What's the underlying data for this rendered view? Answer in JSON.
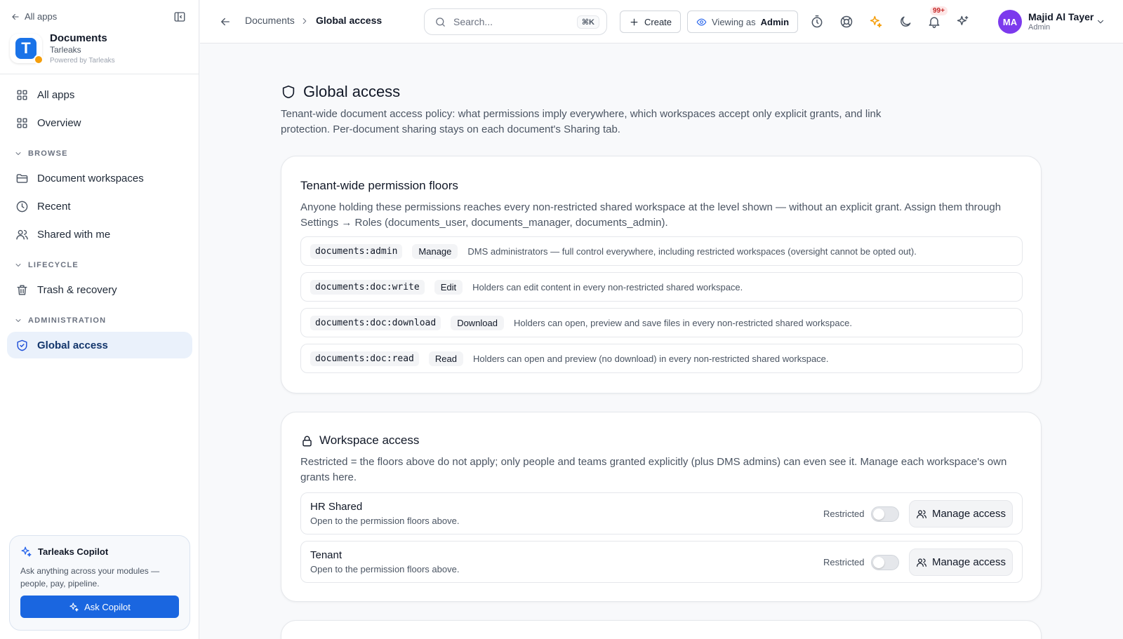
{
  "sidebar": {
    "all_apps": "All apps",
    "app": {
      "name": "Documents",
      "org": "Tarleaks",
      "powered": "Powered by Tarleaks",
      "logo_letter": "T"
    },
    "nav_top": [
      {
        "label": "All apps",
        "icon": "grid-icon"
      },
      {
        "label": "Overview",
        "icon": "grid-icon"
      }
    ],
    "sections": {
      "browse": "BROWSE",
      "lifecycle": "LIFECYCLE",
      "administration": "ADMINISTRATION"
    },
    "browse_items": [
      {
        "label": "Document workspaces",
        "icon": "folder-icon"
      },
      {
        "label": "Recent",
        "icon": "clock-icon"
      },
      {
        "label": "Shared with me",
        "icon": "users-icon"
      }
    ],
    "lifecycle_items": [
      {
        "label": "Trash & recovery",
        "icon": "trash-icon"
      }
    ],
    "admin_items": [
      {
        "label": "Global access",
        "icon": "shield-check-icon",
        "active": true
      }
    ],
    "copilot": {
      "title": "Tarleaks Copilot",
      "desc": "Ask anything across your modules — people, pay, pipeline.",
      "button": "Ask Copilot"
    }
  },
  "topbar": {
    "breadcrumb": [
      "Documents",
      "Global access"
    ],
    "search": {
      "placeholder": "Search...",
      "shortcut": "⌘K"
    },
    "create": "Create",
    "viewing_as": {
      "label": "Viewing as",
      "role": "Admin"
    },
    "notifications_badge": "99+",
    "user": {
      "initials": "MA",
      "name": "Majid Al Tayer",
      "role": "Admin"
    }
  },
  "page": {
    "title": "Global access",
    "desc": "Tenant-wide document access policy: what permissions imply everywhere, which workspaces accept only explicit grants, and link protection. Per-document sharing stays on each document's Sharing tab."
  },
  "floors": {
    "title": "Tenant-wide permission floors",
    "desc": "Anyone holding these permissions reaches every non-restricted shared workspace at the level shown — without an explicit grant. Assign them through Settings → Roles (documents_user, documents_manager, documents_admin).",
    "rows": [
      {
        "code": "documents:admin",
        "level": "Manage",
        "desc": "DMS administrators — full control everywhere, including restricted workspaces (oversight cannot be opted out)."
      },
      {
        "code": "documents:doc:write",
        "level": "Edit",
        "desc": "Holders can edit content in every non-restricted shared workspace."
      },
      {
        "code": "documents:doc:download",
        "level": "Download",
        "desc": "Holders can open, preview and save files in every non-restricted shared workspace."
      },
      {
        "code": "documents:doc:read",
        "level": "Read",
        "desc": "Holders can open and preview (no download) in every non-restricted shared workspace."
      }
    ]
  },
  "workspaces": {
    "title": "Workspace access",
    "desc": "Restricted = the floors above do not apply; only people and teams granted explicitly (plus DMS admins) can even see it. Manage each workspace's own grants here.",
    "rows": [
      {
        "name": "HR Shared",
        "sub": "Open to the permission floors above.",
        "restricted_label": "Restricted",
        "restricted": false,
        "button": "Manage access"
      },
      {
        "name": "Tenant",
        "sub": "Open to the permission floors above.",
        "restricted_label": "Restricted",
        "restricted": false,
        "button": "Manage access"
      }
    ]
  },
  "colors": {
    "accent": "#1a66e0",
    "active_bg": "#eaf1fb",
    "avatar": "#7c3aed",
    "spark": "#f59e0b"
  }
}
